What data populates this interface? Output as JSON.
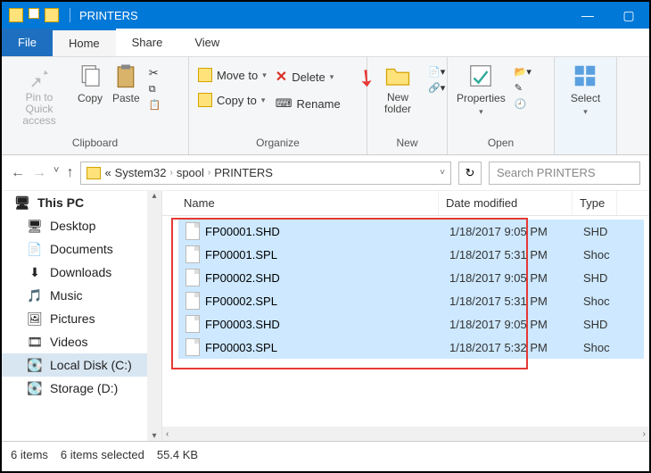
{
  "title": "PRINTERS",
  "window": {
    "min": "—",
    "max": "▢",
    "close": "✕"
  },
  "menu": {
    "file": "File",
    "tabs": [
      "Home",
      "Share",
      "View"
    ],
    "active": 0
  },
  "ribbon": {
    "clipboard": {
      "label": "Clipboard",
      "pin": "Pin to Quick access",
      "copy": "Copy",
      "paste": "Paste"
    },
    "organize": {
      "label": "Organize",
      "move": "Move to",
      "copyto": "Copy to",
      "delete": "Delete",
      "rename": "Rename"
    },
    "new": {
      "label": "New",
      "newfolder": "New folder"
    },
    "open": {
      "label": "Open",
      "properties": "Properties"
    },
    "select": {
      "label": "Select",
      "btn": "Select"
    }
  },
  "breadcrumb": {
    "pre": "«",
    "parts": [
      "System32",
      "spool",
      "PRINTERS"
    ]
  },
  "search": {
    "placeholder": "Search PRINTERS"
  },
  "columns": {
    "name": "Name",
    "date": "Date modified",
    "type": "Type"
  },
  "sidebar": {
    "top": "This PC",
    "items": [
      {
        "label": "Desktop",
        "icon": "🖥"
      },
      {
        "label": "Documents",
        "icon": "📄"
      },
      {
        "label": "Downloads",
        "icon": "⬇"
      },
      {
        "label": "Music",
        "icon": "🎵"
      },
      {
        "label": "Pictures",
        "icon": "🖼"
      },
      {
        "label": "Videos",
        "icon": "🎞"
      },
      {
        "label": "Local Disk (C:)",
        "icon": "💽",
        "selected": true
      },
      {
        "label": "Storage (D:)",
        "icon": "💽"
      }
    ]
  },
  "files": [
    {
      "name": "FP00001.SHD",
      "date": "1/18/2017 9:05 PM",
      "type": "SHD"
    },
    {
      "name": "FP00001.SPL",
      "date": "1/18/2017 5:31 PM",
      "type": "Shoc"
    },
    {
      "name": "FP00002.SHD",
      "date": "1/18/2017 9:05 PM",
      "type": "SHD"
    },
    {
      "name": "FP00002.SPL",
      "date": "1/18/2017 5:31 PM",
      "type": "Shoc"
    },
    {
      "name": "FP00003.SHD",
      "date": "1/18/2017 9:05 PM",
      "type": "SHD"
    },
    {
      "name": "FP00003.SPL",
      "date": "1/18/2017 5:32 PM",
      "type": "Shoc"
    }
  ],
  "status": {
    "count": "6 items",
    "selected": "6 items selected",
    "size": "55.4 KB"
  }
}
